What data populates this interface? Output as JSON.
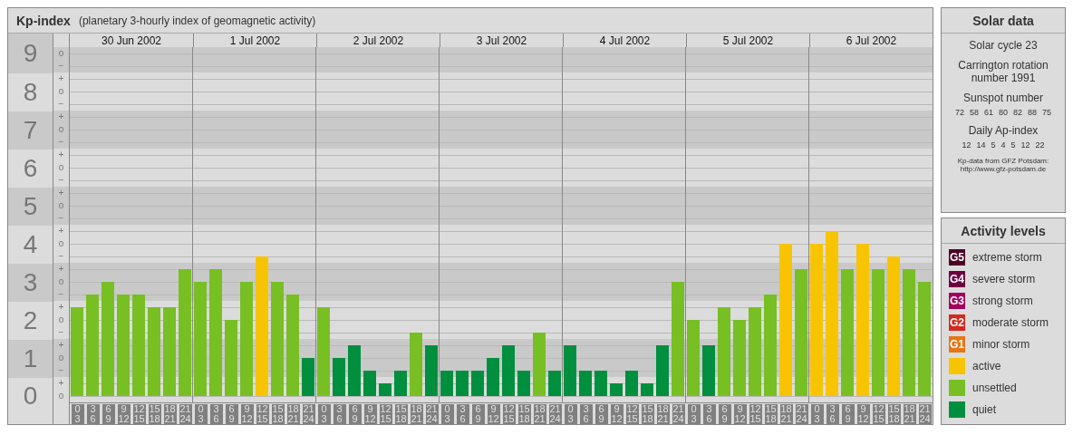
{
  "header": {
    "title": "Kp-index",
    "subtitle": "(planetary 3-hourly index of geomagnetic activity)"
  },
  "kp_axis": {
    "marks": [
      "o",
      "−",
      "+",
      "o",
      "−",
      "+",
      "o",
      "−",
      "+",
      "o",
      "−",
      "+",
      "o",
      "−",
      "+",
      "o",
      "−",
      "+",
      "o",
      "−",
      "+",
      "o",
      "−",
      "+",
      "o",
      "−",
      "+",
      "o"
    ]
  },
  "days": [
    "30 Jun 2002",
    "1 Jul 2002",
    "2 Jul 2002",
    "3 Jul 2002",
    "4 Jul 2002",
    "5 Jul 2002",
    "6 Jul 2002"
  ],
  "chart_data": {
    "type": "bar",
    "grid": true,
    "ylim": [
      0,
      9
    ],
    "yticks": [
      {
        "value": 9,
        "label": "9"
      },
      {
        "value": 8,
        "label": "8"
      },
      {
        "value": 7,
        "label": "7"
      },
      {
        "value": 6,
        "label": "6"
      },
      {
        "value": 5,
        "label": "5"
      },
      {
        "value": 4,
        "label": "4"
      },
      {
        "value": 3,
        "label": "3"
      },
      {
        "value": 2,
        "label": "2"
      },
      {
        "value": 1,
        "label": "1"
      },
      {
        "value": 0,
        "label": "0"
      }
    ],
    "categories": [
      "0 3",
      "3 6",
      "6 9",
      "9 12",
      "12 15",
      "15 18",
      "18 21",
      "21 24",
      "0 3",
      "3 6",
      "6 9",
      "9 12",
      "12 15",
      "15 18",
      "18 21",
      "21 24",
      "0 3",
      "3 6",
      "6 9",
      "9 12",
      "12 15",
      "15 18",
      "18 21",
      "21 24",
      "0 3",
      "3 6",
      "6 9",
      "9 12",
      "12 15",
      "15 18",
      "18 21",
      "21 24",
      "0 3",
      "3 6",
      "6 9",
      "9 12",
      "12 15",
      "15 18",
      "18 21",
      "21 24",
      "0 3",
      "3 6",
      "6 9",
      "9 12",
      "12 15",
      "15 18",
      "18 21",
      "21 24",
      "0 3",
      "3 6",
      "6 9",
      "9 12",
      "12 15",
      "15 18",
      "18 21",
      "21 24"
    ],
    "series": [
      {
        "color": "#f8c400",
        "values": [
          null,
          null,
          null,
          null,
          null,
          null,
          null,
          null,
          null,
          null,
          null,
          null,
          3.67,
          null,
          null,
          null,
          null,
          null,
          null,
          null,
          null,
          null,
          null,
          null,
          null,
          null,
          null,
          null,
          null,
          null,
          null,
          null,
          null,
          null,
          null,
          null,
          null,
          null,
          null,
          null,
          null,
          null,
          null,
          null,
          null,
          null,
          4,
          null,
          4,
          4.33,
          null,
          4,
          null,
          3.67,
          null,
          null
        ]
      },
      {
        "color": "#77bf23",
        "values": [
          2.33,
          2.67,
          3,
          2.67,
          2.67,
          2.33,
          2.33,
          3.33,
          3,
          3.33,
          2,
          3,
          null,
          3,
          2.67,
          null,
          2.33,
          null,
          null,
          null,
          null,
          null,
          1.67,
          null,
          null,
          null,
          null,
          null,
          null,
          null,
          1.67,
          null,
          null,
          null,
          null,
          null,
          null,
          null,
          null,
          3,
          2,
          null,
          2.33,
          2,
          2.33,
          2.67,
          null,
          3.33,
          null,
          null,
          3.33,
          null,
          3.33,
          null,
          3.33,
          3
        ]
      },
      {
        "color": "#008f3e",
        "values": [
          null,
          null,
          null,
          null,
          null,
          null,
          null,
          null,
          null,
          null,
          null,
          null,
          null,
          null,
          null,
          1,
          null,
          1,
          1.33,
          0.67,
          0.33,
          0.67,
          null,
          1.33,
          0.67,
          0.67,
          0.67,
          1,
          1.33,
          0.67,
          null,
          0.67,
          1.33,
          0.67,
          0.67,
          0.33,
          0.67,
          0.33,
          1.33,
          null,
          null,
          1.33,
          null,
          null,
          null,
          null,
          null,
          null,
          null,
          null,
          null,
          null,
          null,
          null,
          null,
          null
        ]
      }
    ]
  },
  "solar_data": {
    "title": "Solar data",
    "cycle": "Solar cycle 23",
    "carrington": "Carrington rotation number 1991",
    "sunspot_heading": "Sunspot number",
    "sunspot_values": [
      "72",
      "58",
      "61",
      "80",
      "82",
      "88",
      "75"
    ],
    "ap_heading": "Daily Ap-index",
    "ap_values": [
      "12",
      "14",
      "5",
      "4",
      "5",
      "12",
      "22"
    ],
    "source": "Kp-data from GFZ Potsdam: http://www.gfz-potsdam.de"
  },
  "legend": {
    "title": "Activity levels",
    "items": [
      {
        "kind": "storm",
        "badge": "G5",
        "label": "extreme storm",
        "color": "#4d0026"
      },
      {
        "kind": "storm",
        "badge": "G4",
        "label": "severe storm",
        "color": "#6e0040"
      },
      {
        "kind": "storm",
        "badge": "G3",
        "label": "strong storm",
        "color": "#a3005c"
      },
      {
        "kind": "storm",
        "badge": "G2",
        "label": "moderate storm",
        "color": "#d22a1c"
      },
      {
        "kind": "storm",
        "badge": "G1",
        "label": "minor storm",
        "color": "#e47614"
      },
      {
        "kind": "plain",
        "label": "active",
        "color": "#f8c400"
      },
      {
        "kind": "plain",
        "label": "unsettled",
        "color": "#77bf23"
      },
      {
        "kind": "plain",
        "label": "quiet",
        "color": "#008f3e"
      }
    ]
  }
}
